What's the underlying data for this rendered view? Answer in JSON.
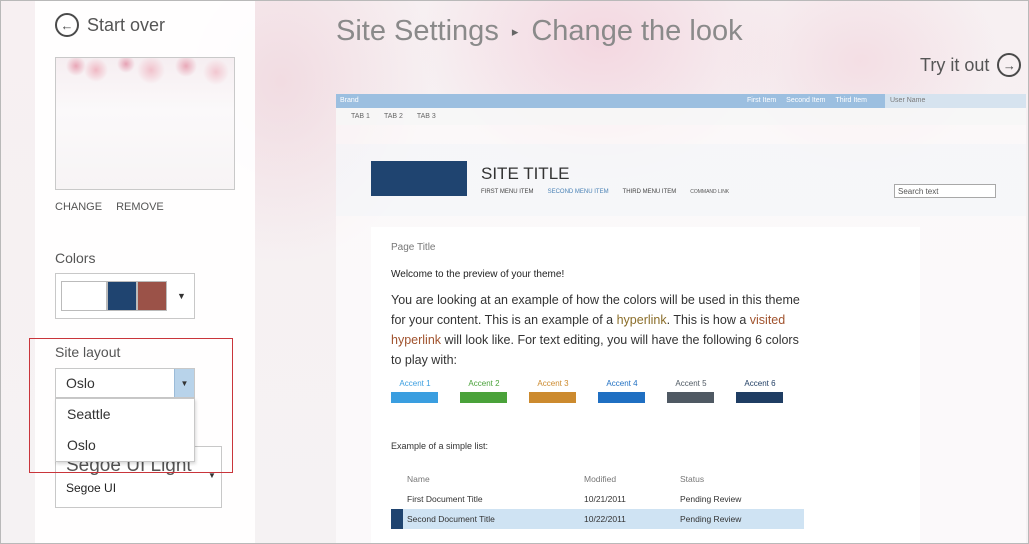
{
  "left_panel": {
    "start_over": "Start over",
    "image_links": {
      "change": "CHANGE",
      "remove": "REMOVE"
    },
    "colors_label": "Colors",
    "swatches": [
      "#ffffff",
      "#1f4470",
      "#9b5248"
    ],
    "site_layout_label": "Site layout",
    "site_layout_value": "Oslo",
    "site_layout_options": [
      "Seattle",
      "Oslo"
    ],
    "font_heading": "Segoe UI Light",
    "font_body": "Segoe UI"
  },
  "header": {
    "breadcrumb_root": "Site Settings",
    "separator": "▸",
    "breadcrumb_current": "Change the look",
    "try_it_out": "Try it out"
  },
  "preview": {
    "suite_bar": {
      "brand": "Brand",
      "links": [
        "First Item",
        "Second Item",
        "Third Item"
      ],
      "user_name": "User Name"
    },
    "tabs": [
      "TAB 1",
      "TAB 2",
      "TAB 3"
    ],
    "site_title": "SITE TITLE",
    "nav_items": [
      "FIRST MENU ITEM",
      "SECOND MENU ITEM",
      "THIRD MENU ITEM",
      "COMMAND LINK"
    ],
    "search_placeholder": "Search text",
    "page_title": "Page Title",
    "welcome": "Welcome to the preview of your theme!",
    "body_part1": "You are looking at an example of how the colors will be used in this theme for your content. This is an example of a ",
    "hyperlink": "hyperlink",
    "body_part2": ". This is how a ",
    "visited_hyperlink": "visited hyperlink",
    "body_part3": " will look like. For text editing, you will have the following 6 colors to play with:",
    "accents": [
      {
        "label": "Accent 1",
        "color": "#3a9ee0"
      },
      {
        "label": "Accent 2",
        "color": "#4aa23a"
      },
      {
        "label": "Accent 3",
        "color": "#cc8a2e"
      },
      {
        "label": "Accent 4",
        "color": "#1f6fc2"
      },
      {
        "label": "Accent 5",
        "color": "#4f5963"
      },
      {
        "label": "Accent 6",
        "color": "#1f3d63"
      }
    ],
    "list_title": "Example of a simple list:",
    "list_headers": {
      "name": "Name",
      "modified": "Modified",
      "status": "Status"
    },
    "list_rows": [
      {
        "name": "First Document Title",
        "modified": "10/21/2011",
        "status": "Pending Review"
      },
      {
        "name": "Second Document Title",
        "modified": "10/22/2011",
        "status": "Pending Review"
      }
    ]
  }
}
